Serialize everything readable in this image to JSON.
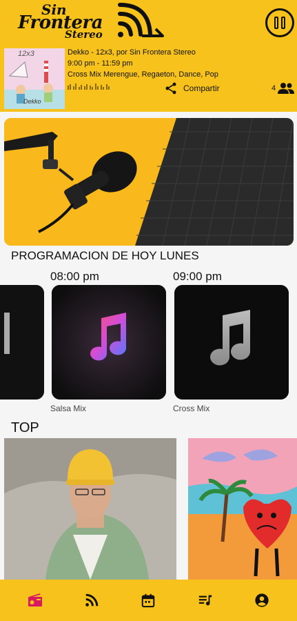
{
  "brand": {
    "line1": "Sin",
    "line2": "Frontera",
    "line3": "Stereo"
  },
  "now_playing": {
    "title_line": "Dekko  -  12x3, por Sin Frontera Stereo",
    "time_line": "9:00 pm - 11:59 pm",
    "genre_line": "Cross Mix  Merengue, Regaeton, Dance, Pop",
    "share_label": "Compartir",
    "listeners": "4",
    "cover_text": "12x3",
    "cover_caption": "Dekko"
  },
  "schedule": {
    "section_title": "PROGRAMACION DE HOY LUNES",
    "items": [
      {
        "time": "",
        "name": ""
      },
      {
        "time": "08:00 pm",
        "name": "Salsa Mix"
      },
      {
        "time": "09:00 pm",
        "name": "Cross Mix"
      }
    ]
  },
  "top": {
    "section_title": "TOP"
  },
  "nav": [
    {
      "icon": "radio-icon",
      "active": true
    },
    {
      "icon": "rss-icon",
      "active": false
    },
    {
      "icon": "calendar-icon",
      "active": false
    },
    {
      "icon": "playlist-icon",
      "active": false
    },
    {
      "icon": "account-icon",
      "active": false
    }
  ],
  "colors": {
    "brand_yellow": "#f7c21b",
    "active_nav": "#d81b60",
    "background": "#f5f5f5"
  }
}
